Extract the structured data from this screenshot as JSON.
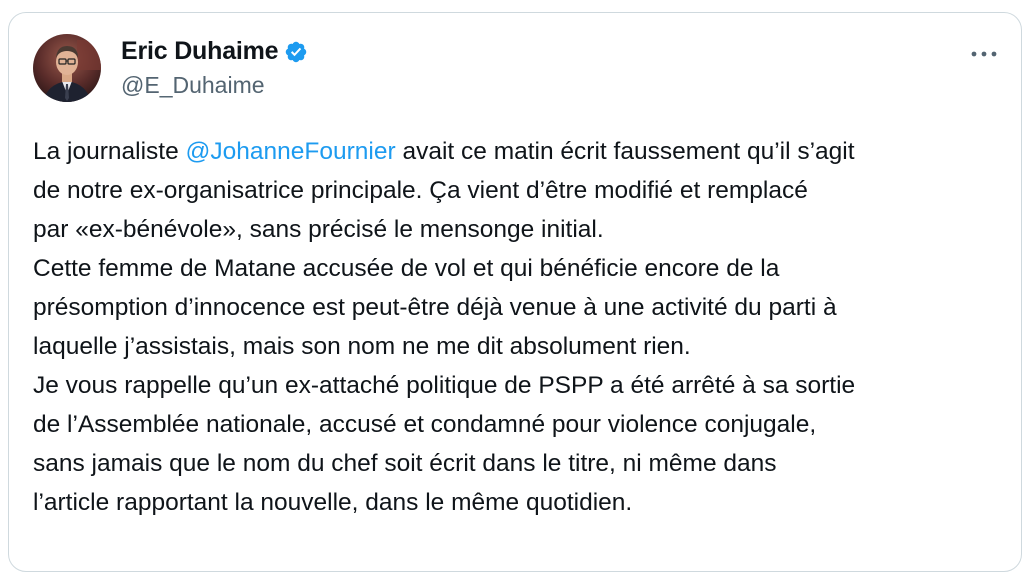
{
  "author": {
    "name": "Eric Duhaime",
    "handle": "@E_Duhaime",
    "verified_color": "#1d9bf0"
  },
  "menu_icon": "more-horizontal-icon",
  "tweet": {
    "line1_before": "La journaliste ",
    "mention": "@JohanneFournier",
    "line1_after": " avait ce matin écrit faussement qu’il s’agit",
    "line2": "de notre ex-organisatrice principale. Ça vient d’être modifié et remplacé",
    "line3": "par «ex-bénévole», sans précisé le mensonge initial.",
    "line4": "Cette femme de Matane accusée de vol et qui bénéficie encore de la",
    "line5": "présomption d’innocence est peut-être déjà venue à une activité du parti à",
    "line6": "laquelle j’assistais, mais son nom ne me dit absolument rien.",
    "line7": "Je vous rappelle qu’un ex-attaché politique de PSPP a été arrêté à sa sortie",
    "line8": "de l’Assemblée nationale, accusé et condamné pour violence conjugale,",
    "line9": "sans jamais que le nom du chef soit écrit dans le titre, ni même dans",
    "line10": "l’article rapportant la nouvelle, dans le même quotidien."
  }
}
